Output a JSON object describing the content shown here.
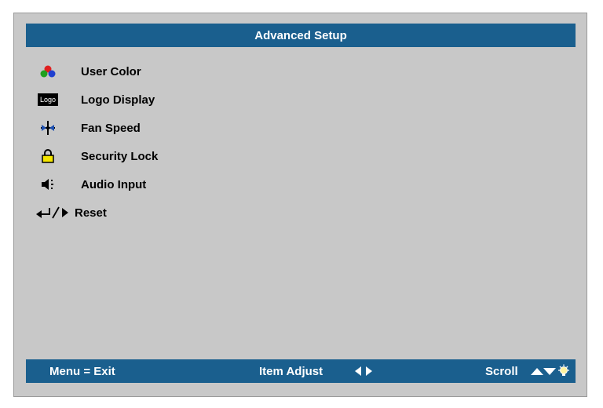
{
  "title": "Advanced Setup",
  "menu": [
    {
      "label": "User Color",
      "icon": "rgb-dots-icon"
    },
    {
      "label": "Logo Display",
      "icon": "logo-icon",
      "icon_text": "Logo"
    },
    {
      "label": "Fan Speed",
      "icon": "fan-icon"
    },
    {
      "label": "Security Lock",
      "icon": "padlock-icon"
    },
    {
      "label": "Audio Input",
      "icon": "speaker-icon"
    },
    {
      "label": "Reset",
      "icon": "enter-right-icon"
    }
  ],
  "footer": {
    "exit": "Menu = Exit",
    "adjust": "Item Adjust",
    "scroll": "Scroll"
  },
  "colors": {
    "bar": "#1a5f8e",
    "panel": "#c8c8c8"
  }
}
